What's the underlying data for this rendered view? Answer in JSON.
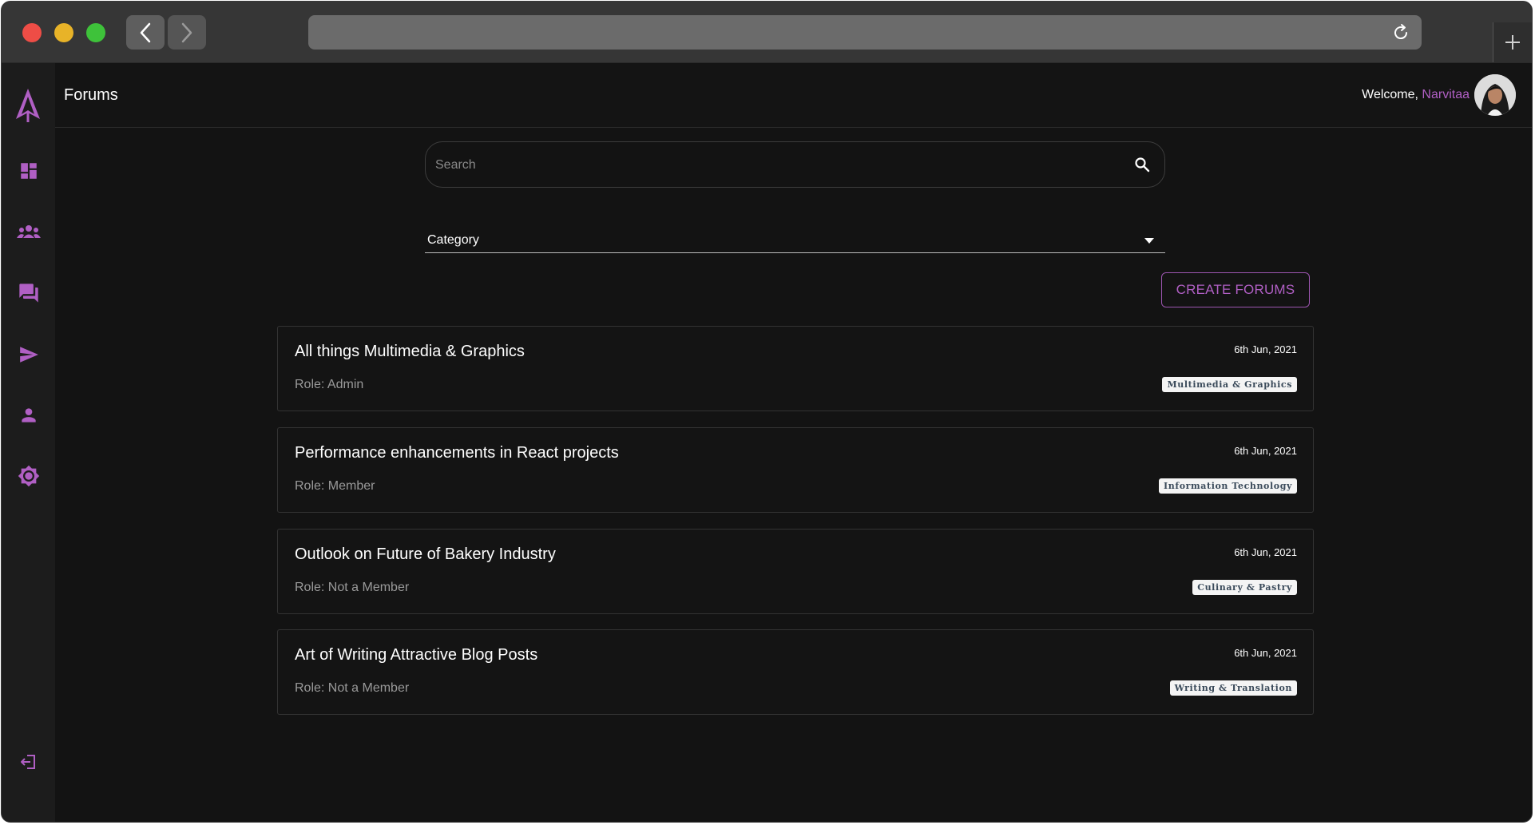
{
  "header": {
    "title": "Forums",
    "welcome_text": "Welcome,",
    "username": "Narvitaa"
  },
  "sidebar": {
    "items": [
      {
        "icon": "logo-icon"
      },
      {
        "icon": "dashboard-icon"
      },
      {
        "icon": "groups-icon"
      },
      {
        "icon": "forum-icon"
      },
      {
        "icon": "send-icon"
      },
      {
        "icon": "person-icon"
      },
      {
        "icon": "brightness-icon"
      },
      {
        "icon": "logout-icon"
      }
    ]
  },
  "search": {
    "placeholder": "Search"
  },
  "filter": {
    "category_label": "Category"
  },
  "actions": {
    "create_label": "CREATE FORUMS"
  },
  "forums": [
    {
      "title": "All things Multimedia & Graphics",
      "role": "Role: Admin",
      "date": "6th Jun, 2021",
      "tag": "Multimedia & Graphics"
    },
    {
      "title": "Performance enhancements in React projects",
      "role": "Role: Member",
      "date": "6th Jun, 2021",
      "tag": "Information Technology"
    },
    {
      "title": "Outlook on Future of Bakery Industry",
      "role": "Role: Not a Member",
      "date": "6th Jun, 2021",
      "tag": "Culinary & Pastry"
    },
    {
      "title": "Art of Writing Attractive Blog Posts",
      "role": "Role: Not a Member",
      "date": "6th Jun, 2021",
      "tag": "Writing & Translation"
    }
  ],
  "colors": {
    "accent": "#b05fc4",
    "background": "#131313",
    "sidebar": "#1c1c1c"
  }
}
